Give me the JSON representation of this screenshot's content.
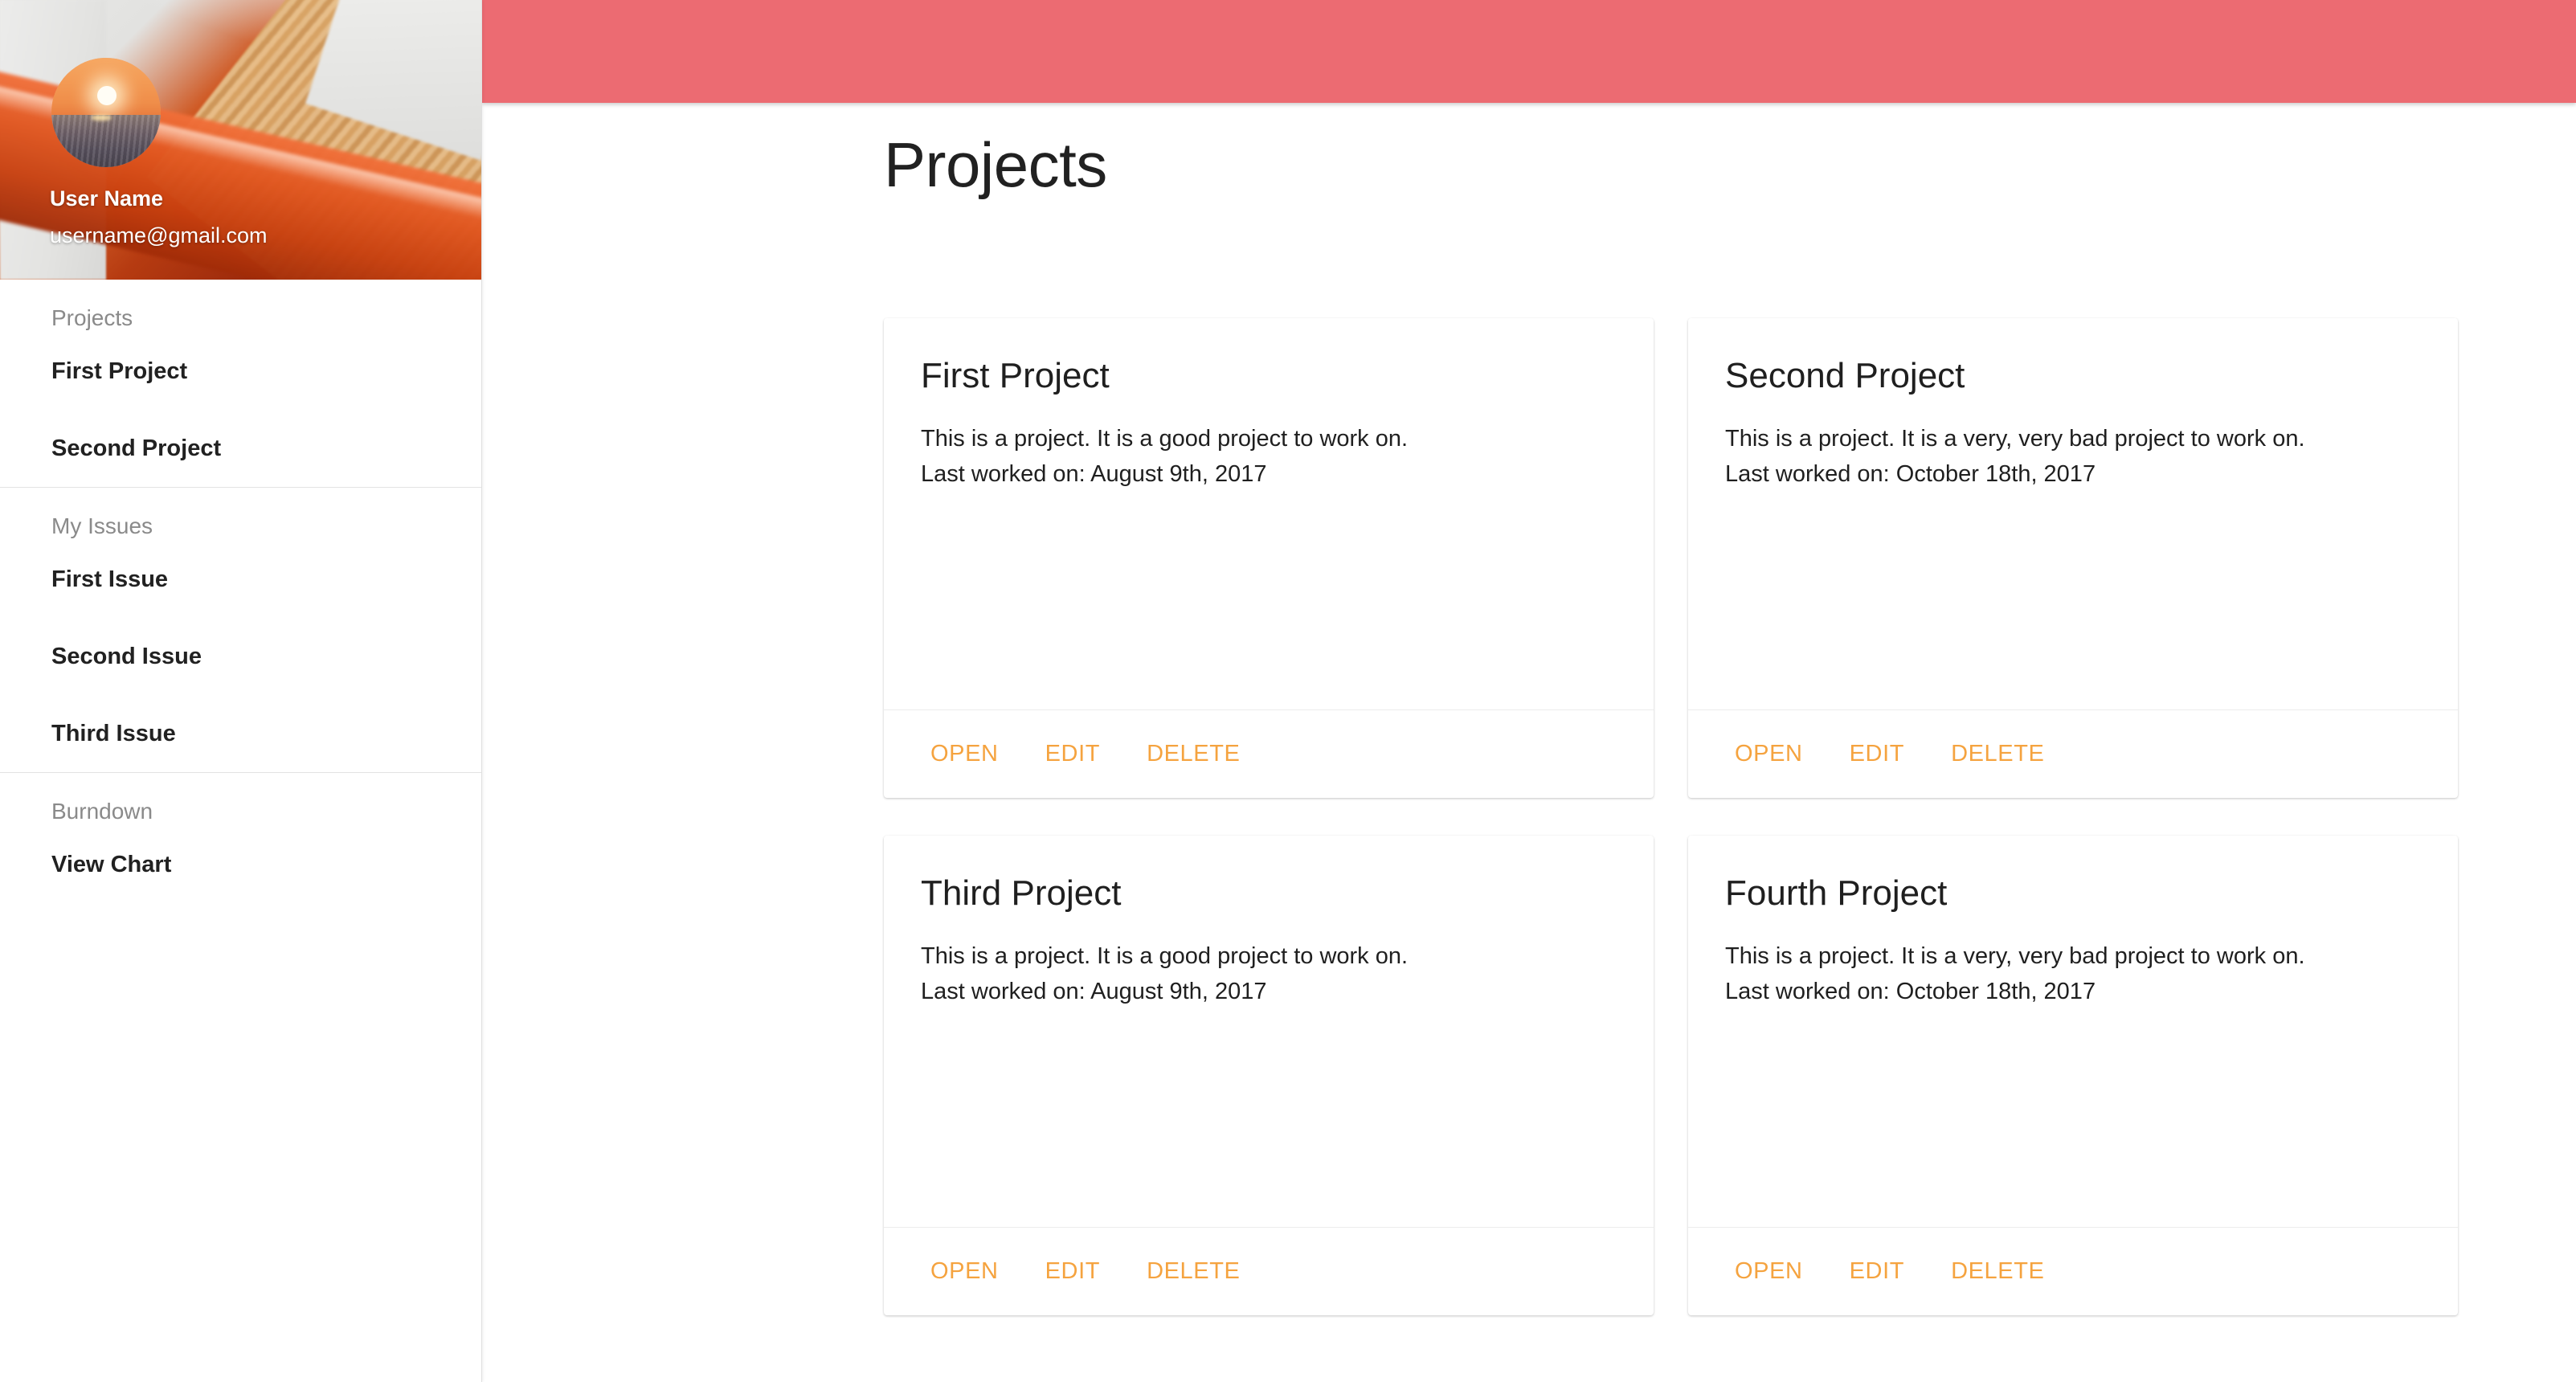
{
  "theme": {
    "topbar_color": "#ec6b72",
    "action_color": "#f5a33f",
    "text_color": "#212121",
    "muted_text_color": "#8a8a8a"
  },
  "sidebar": {
    "user": {
      "name": "User Name",
      "email": "username@gmail.com",
      "avatar_icon": "sunset-ocean-avatar"
    },
    "sections": [
      {
        "title": "Projects",
        "items": [
          {
            "label": "First Project"
          },
          {
            "label": "Second Project"
          }
        ]
      },
      {
        "title": "My Issues",
        "items": [
          {
            "label": "First Issue"
          },
          {
            "label": "Second Issue"
          },
          {
            "label": "Third Issue"
          }
        ]
      },
      {
        "title": "Burndown",
        "items": [
          {
            "label": "View Chart"
          }
        ]
      }
    ]
  },
  "main": {
    "page_title": "Projects",
    "cards": [
      {
        "title": "First Project",
        "description": "This is a project. It is a good project to work on.",
        "last_worked": "Last worked on: August 9th, 2017",
        "actions": [
          "OPEN",
          "EDIT",
          "DELETE"
        ]
      },
      {
        "title": "Second Project",
        "description": "This is a project. It is a very, very bad project to work on.",
        "last_worked": "Last worked on: October 18th, 2017",
        "actions": [
          "OPEN",
          "EDIT",
          "DELETE"
        ]
      },
      {
        "title": "Third Project",
        "description": "This is a project. It is a good project to work on.",
        "last_worked": "Last worked on: August 9th, 2017",
        "actions": [
          "OPEN",
          "EDIT",
          "DELETE"
        ]
      },
      {
        "title": "Fourth Project",
        "description": "This is a project. It is a very, very bad project to work on.",
        "last_worked": "Last worked on: October 18th, 2017",
        "actions": [
          "OPEN",
          "EDIT",
          "DELETE"
        ]
      }
    ]
  }
}
